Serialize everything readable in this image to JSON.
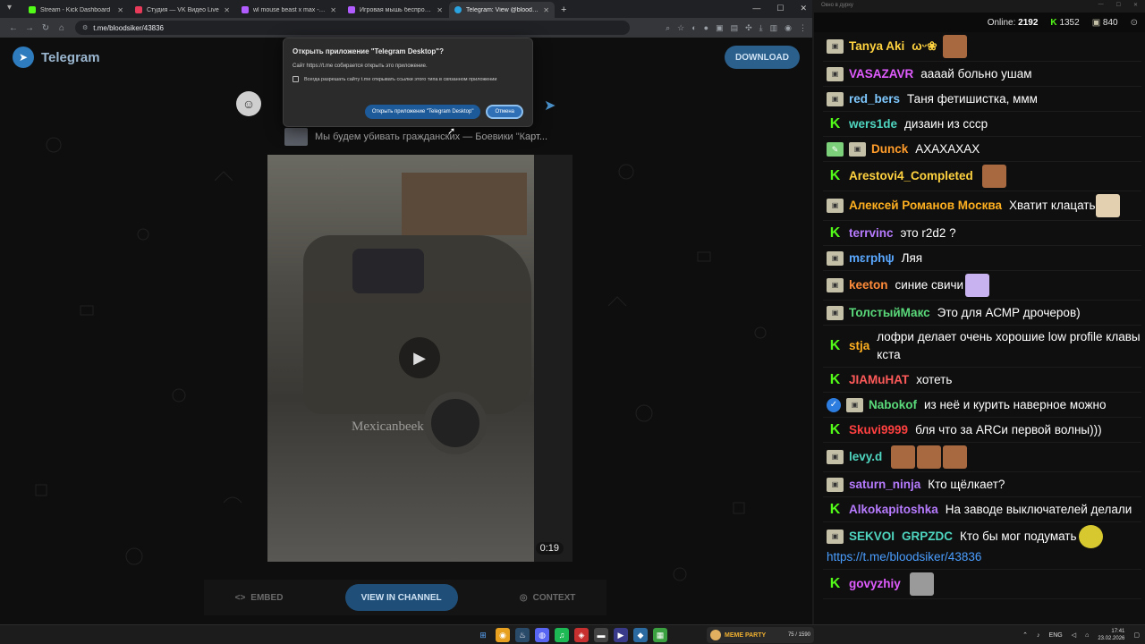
{
  "browser": {
    "tabs": [
      {
        "label": "Stream - Kick Dashboard",
        "color": "#53fc18"
      },
      {
        "label": "Студия — VK Видео Live",
        "color": "#e83b5a"
      },
      {
        "label": "wl mouse beast x max - купить",
        "color": "#b15cff"
      },
      {
        "label": "Игровая мышь беспроводная",
        "color": "#b15cff"
      },
      {
        "label": "Telegram: View @bloodsiker",
        "color": "#2aa3e0"
      }
    ],
    "url": "t.me/bloodsiker/43836"
  },
  "telegram": {
    "brand": "Telegram",
    "download": "DOWNLOAD",
    "reply_text": "Мы будем убивать гражданских — Боевики \"Карт...",
    "video_watermark": "Mexicanbeek",
    "video_duration": "0:19",
    "embed": "EMBED",
    "view_channel": "VIEW IN CHANNEL",
    "context": "CONTEXT"
  },
  "dialog": {
    "title": "Открыть приложение \"Telegram Desktop\"?",
    "text": "Сайт https://t.me собирается открыть это приложение.",
    "checkbox": "Всегда разрешать сайту t.me открывать ссылки этого типа в связанном приложении",
    "open": "Открыть приложение \"Telegram Desktop\"",
    "cancel": "Отмена"
  },
  "chat": {
    "window_title": "Окно в дурку",
    "online_label": "Online:",
    "online_count": "2192",
    "kick_count": "1352",
    "vk_count": "840",
    "messages": [
      {
        "nick": "Tanya Aki",
        "color": "#ffd23f",
        "text": "",
        "suffix": "ωᵕ❀"
      },
      {
        "nick": "VASAZAVR",
        "color": "#e05cff",
        "text": "аааай больно ушам"
      },
      {
        "nick": "red_bers",
        "color": "#7ec8ff",
        "text": "Таня фетишистка, ммм"
      },
      {
        "nick": "wers1de",
        "color": "#4fd6c0",
        "text": "дизаин из ссср"
      },
      {
        "nick": "Dunck",
        "color": "#ff9c2a",
        "text": "АХАХАХАХ"
      },
      {
        "nick": "Arestovi4_Completed",
        "color": "#ffd23f",
        "text": ""
      },
      {
        "nick": "Алексей Романов Москва",
        "color": "#ffb020",
        "text": "Хватит клацать"
      },
      {
        "nick": "terrvinc",
        "color": "#b77bff",
        "text": "это r2d2 ?"
      },
      {
        "nick": "mɛrphψ",
        "color": "#5aa8ff",
        "text": "Ляя"
      },
      {
        "nick": "keeton",
        "color": "#ff8c3a",
        "text": "синие свичи"
      },
      {
        "nick": "ТолстыйМакс",
        "color": "#5ad97a",
        "text": "Это для АСМР дрочеров)"
      },
      {
        "nick": "stja",
        "color": "#ffb020",
        "text": "лофри делает очень хорошие low profile клавы кста"
      },
      {
        "nick": "JIAMuHAT",
        "color": "#ff5a5a",
        "text": "хотеть"
      },
      {
        "nick": "Nabokof",
        "color": "#5ad97a",
        "text": "из неё и курить наверное можно"
      },
      {
        "nick": "Skuvi9999",
        "color": "#ff4040",
        "text": "бля что за ARCи первой волны)))"
      },
      {
        "nick": "levy.d",
        "color": "#4fd6c0",
        "text": ""
      },
      {
        "nick": "saturn_ninja",
        "color": "#b77bff",
        "text": "Кто щёлкает?"
      },
      {
        "nick": "Alkokapitoshka",
        "color": "#b77bff",
        "text": "На заводе выключателей делали"
      },
      {
        "nick": "SEKVOI",
        "color": "#4fd6c0",
        "text": "Кто бы мог подумать",
        "mention": "GRPZDC",
        "link": "https://t.me/bloodsiker/43836"
      },
      {
        "nick": "govyzhiy",
        "color": "#e05cff",
        "text": ""
      }
    ]
  },
  "taskbar": {
    "meme_title": "MEME PARTY",
    "meme_count": "75 / 1590",
    "lang": "ENG",
    "time": "17:41",
    "date": "23.02.2026"
  }
}
